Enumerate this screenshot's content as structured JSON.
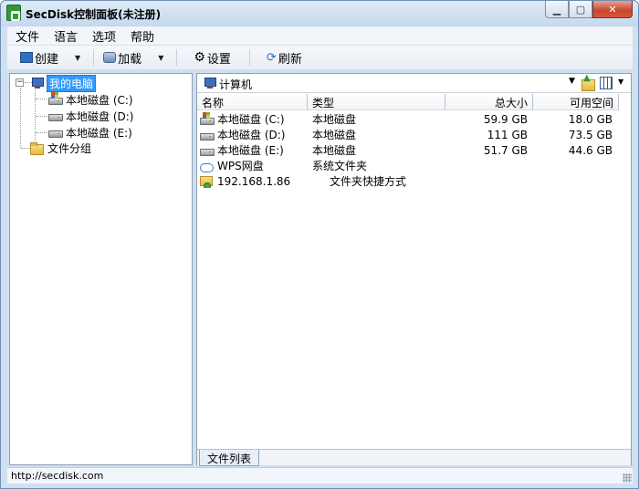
{
  "window": {
    "title": "SecDisk控制面板(未注册)"
  },
  "menu": [
    "文件",
    "语言",
    "选项",
    "帮助"
  ],
  "toolbar": {
    "create": "创建",
    "load": "加载",
    "settings": "设置",
    "refresh": "刷新"
  },
  "tree": {
    "root": "我的电脑",
    "drives": [
      "本地磁盘 (C:)",
      "本地磁盘 (D:)",
      "本地磁盘 (E:)"
    ],
    "group": "文件分组"
  },
  "path": {
    "current": "计算机"
  },
  "list": {
    "columns": [
      "名称",
      "类型",
      "总大小",
      "可用空间"
    ],
    "rows": [
      {
        "name": "本地磁盘 (C:)",
        "type": "本地磁盘",
        "total": "59.9 GB",
        "free": "18.0 GB",
        "icon": "windows-drive-icon"
      },
      {
        "name": "本地磁盘 (D:)",
        "type": "本地磁盘",
        "total": "111 GB",
        "free": "73.5 GB",
        "icon": "drive-icon"
      },
      {
        "name": "本地磁盘 (E:)",
        "type": "本地磁盘",
        "total": "51.7 GB",
        "free": "44.6 GB",
        "icon": "drive-icon"
      },
      {
        "name": "WPS网盘",
        "type": "系统文件夹",
        "total": "",
        "free": "",
        "icon": "cloud-icon"
      },
      {
        "name": "192.168.1.86",
        "type": "文件夹快捷方式",
        "total": "",
        "free": "",
        "icon": "network-folder-icon"
      }
    ]
  },
  "tabs": {
    "file_list": "文件列表"
  },
  "status": {
    "url": "http://secdisk.com"
  }
}
